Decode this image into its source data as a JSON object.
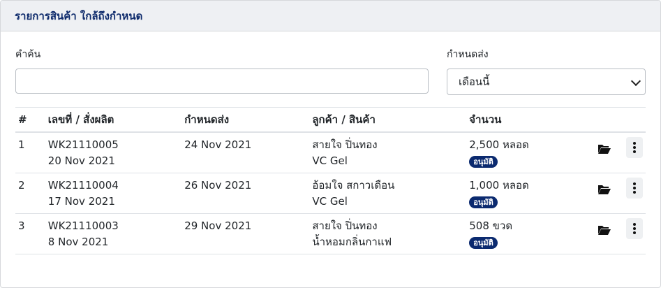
{
  "card": {
    "title": "รายการสินค้า ใกล้ถึงกำหนด"
  },
  "filters": {
    "search_label": "คำค้น",
    "search_value": "",
    "search_placeholder": "",
    "due_label": "กำหนดส่ง",
    "due_selected": "เดือนนี้"
  },
  "table": {
    "headers": [
      "#",
      "เลขที่ / สั่งผลิต",
      "กำหนดส่ง",
      "ลูกค้า / สินค้า",
      "จำนวน"
    ],
    "rows": [
      {
        "idx": "1",
        "order_no": "WK21110005",
        "order_date": "20 Nov 2021",
        "due": "24 Nov 2021",
        "customer": "สายใจ ปิ่นทอง",
        "product": "VC Gel",
        "qty": "2,500 หลอด",
        "status": "อนุมัติ"
      },
      {
        "idx": "2",
        "order_no": "WK21110004",
        "order_date": "17 Nov 2021",
        "due": "26 Nov 2021",
        "customer": "อ้อมใจ สกาวเดือน",
        "product": "VC Gel",
        "qty": "1,000 หลอด",
        "status": "อนุมัติ"
      },
      {
        "idx": "3",
        "order_no": "WK21110003",
        "order_date": "8 Nov 2021",
        "due": "29 Nov 2021",
        "customer": "สายใจ ปิ่นทอง",
        "product": "น้ำหอมกลิ่นกาแฟ",
        "qty": "508 ขวด",
        "status": "อนุมัติ"
      }
    ]
  },
  "icons": {
    "open": "folder-open-icon",
    "more": "more-vertical-icon"
  },
  "colors": {
    "accent": "#0b2a6f",
    "header_bg": "#eef0f3"
  }
}
